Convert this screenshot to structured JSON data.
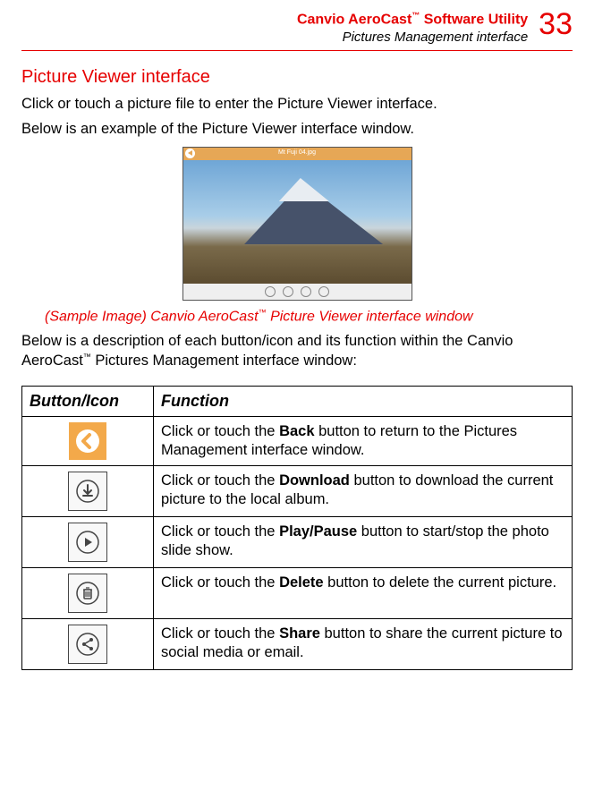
{
  "header": {
    "title_prefix": "Canvio AeroCast",
    "tm": "™",
    "title_suffix": " Software Utility",
    "subtitle": "Pictures Management interface",
    "page_number": "33"
  },
  "section_title": "Picture Viewer interface",
  "intro_line1": "Click or touch a picture file to enter the Picture Viewer interface.",
  "intro_line2": "Below is an example of the Picture Viewer interface window.",
  "sample_filename": "Mt Fuji 04.jpg",
  "caption_prefix": "(Sample Image) Canvio AeroCast",
  "caption_suffix": " Picture Viewer interface window",
  "post_image_1": "Below is a description of each button/icon and its function within the Canvio AeroCast",
  "post_image_2": " Pictures Management interface window:",
  "table": {
    "head_icon": "Button/Icon",
    "head_func": "Function",
    "rows": [
      {
        "icon": "back-icon",
        "pre": "Click or touch the ",
        "bold": "Back",
        "post": " button to return to the Pictures Management interface window."
      },
      {
        "icon": "download-icon",
        "pre": "Click or touch the ",
        "bold": "Download",
        "post": " button to download the current picture to the local album."
      },
      {
        "icon": "play-pause-icon",
        "pre": "Click or touch the ",
        "bold": "Play/Pause",
        "post": " button to start/stop the photo slide show."
      },
      {
        "icon": "delete-icon",
        "pre": "Click or touch the ",
        "bold": "Delete",
        "post": " button to delete the current picture."
      },
      {
        "icon": "share-icon",
        "pre": "Click or touch the ",
        "bold": "Share",
        "post": " button to share the current picture to social media or email."
      }
    ]
  }
}
